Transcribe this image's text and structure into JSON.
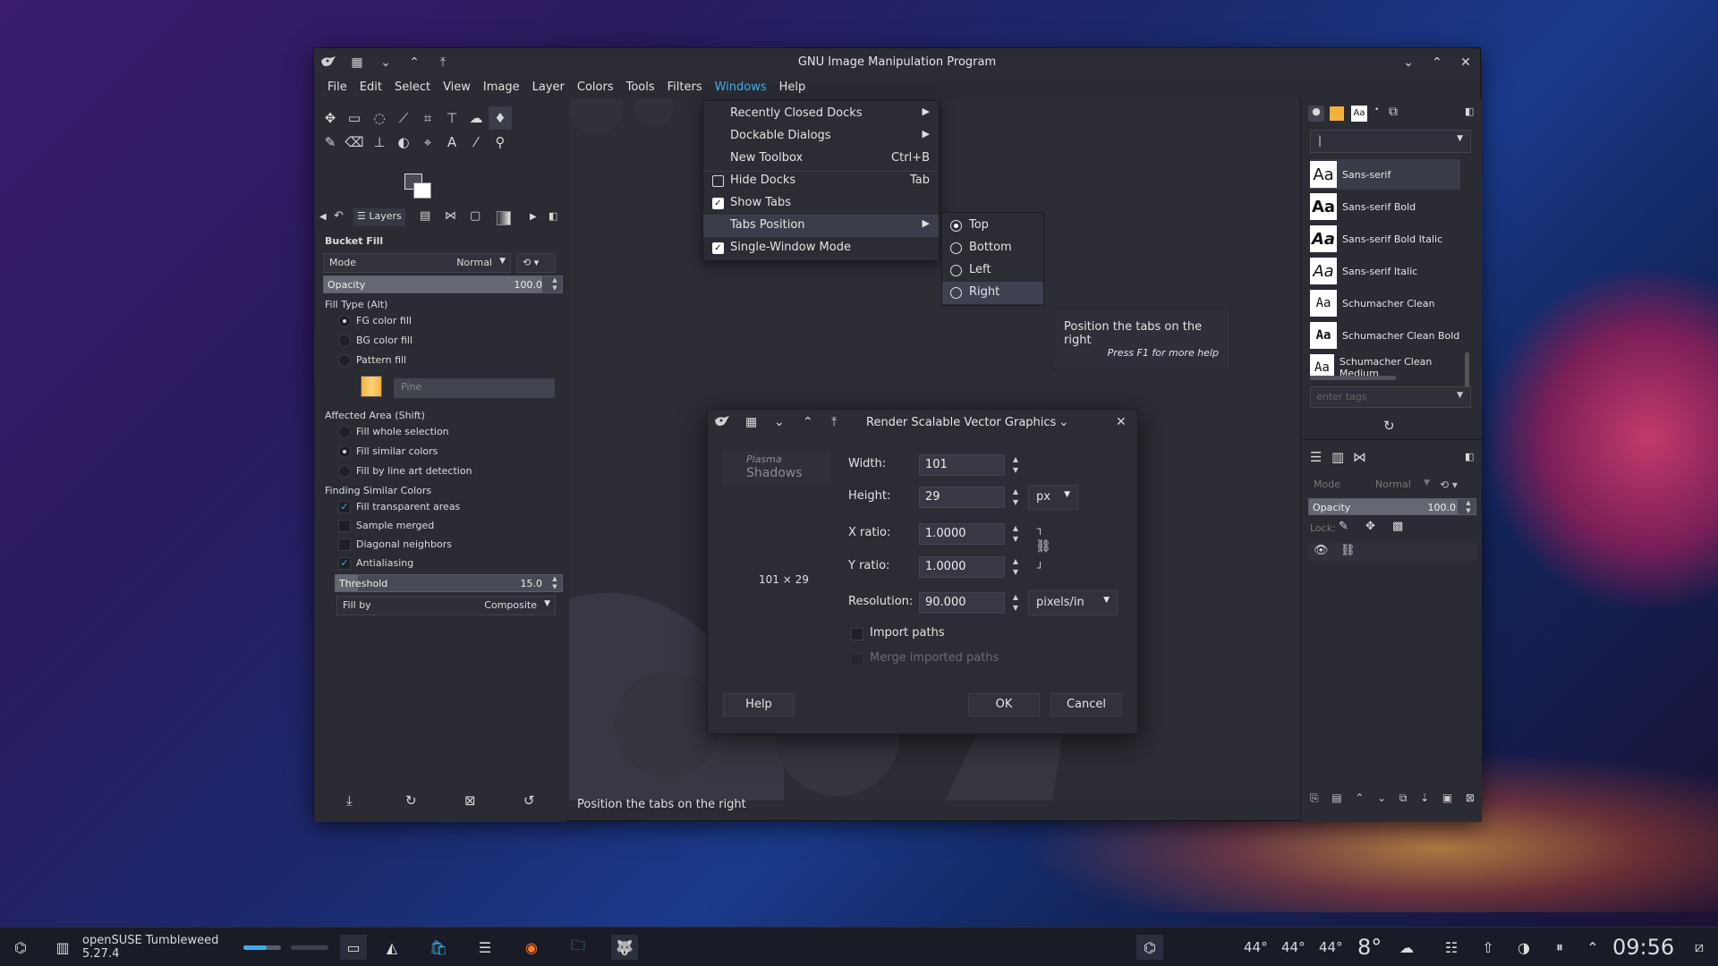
{
  "window": {
    "title": "GNU Image Manipulation Program"
  },
  "menubar": [
    "File",
    "Edit",
    "Select",
    "View",
    "Image",
    "Layer",
    "Colors",
    "Tools",
    "Filters",
    "Windows",
    "Help"
  ],
  "windows_menu": {
    "recently_closed": "Recently Closed Docks",
    "dockable": "Dockable Dialogs",
    "new_toolbox": "New Toolbox",
    "new_toolbox_sc": "Ctrl+B",
    "hide_docks": "Hide Docks",
    "hide_docks_sc": "Tab",
    "show_tabs": "Show Tabs",
    "tabs_position": "Tabs Position",
    "single_window": "Single-Window Mode"
  },
  "tabs_position": {
    "top": "Top",
    "bottom": "Bottom",
    "left": "Left",
    "right": "Right",
    "selected": "Top"
  },
  "tooltip": {
    "text": "Position the tabs on the right",
    "help": "Press F1 for more help"
  },
  "toolbox": {
    "layers_tab": "Layers",
    "tool_name": "Bucket Fill",
    "mode_label": "Mode",
    "mode_value": "Normal",
    "opacity_label": "Opacity",
    "opacity_value": "100.0",
    "fill_type_label": "Fill Type  (Alt)",
    "fg_fill": "FG color fill",
    "bg_fill": "BG color fill",
    "pattern_fill": "Pattern fill",
    "pattern_name": "Pine",
    "affected_label": "Affected Area  (Shift)",
    "fill_whole": "Fill whole selection",
    "fill_similar": "Fill similar colors",
    "fill_lineart": "Fill by line art detection",
    "finding_label": "Finding Similar Colors",
    "fill_transparent": "Fill transparent areas",
    "sample_merged": "Sample merged",
    "diagonal": "Diagonal neighbors",
    "antialiasing": "Antialiasing",
    "threshold_label": "Threshold",
    "threshold_value": "15.0",
    "fillby_label": "Fill by",
    "fillby_value": "Composite"
  },
  "fonts": {
    "items": [
      "Sans-serif",
      "Sans-serif Bold",
      "Sans-serif Bold Italic",
      "Sans-serif Italic",
      "Schumacher Clean",
      "Schumacher Clean Bold",
      "Schumacher Clean Medium"
    ],
    "tags_placeholder": "enter tags",
    "preview_glyph": "Aa"
  },
  "layers_panel": {
    "mode_label": "Mode",
    "mode_value": "Normal",
    "opacity_label": "Opacity",
    "opacity_value": "100.0",
    "lock_label": "Lock:"
  },
  "svg_dialog": {
    "title": "Render Scalable Vector Graphics",
    "preview_text_1": "Plasma",
    "preview_text_2": "Shadows",
    "size_text": "101 × 29",
    "width_label": "Width:",
    "width_value": "101",
    "height_label": "Height:",
    "height_value": "29",
    "unit": "px",
    "xratio_label": "X ratio:",
    "xratio_value": "1.0000",
    "yratio_label": "Y ratio:",
    "yratio_value": "1.0000",
    "resolution_label": "Resolution:",
    "resolution_value": "90.000",
    "resolution_unit": "pixels/in",
    "import_paths": "Import paths",
    "merge_paths": "Merge imported paths",
    "help": "Help",
    "ok": "OK",
    "cancel": "Cancel"
  },
  "statusbar": "Position the tabs on the right",
  "taskbar": {
    "os_label": "openSUSE Tumbleweed 5.27.4",
    "temp1": "44°",
    "temp2": "44°",
    "temp3": "44°",
    "weather": "8°",
    "clock": "09:56"
  },
  "colors": {
    "accent": "#3daee9",
    "panel": "#2a2b33",
    "menu_highlight": "#3b3e4a"
  }
}
